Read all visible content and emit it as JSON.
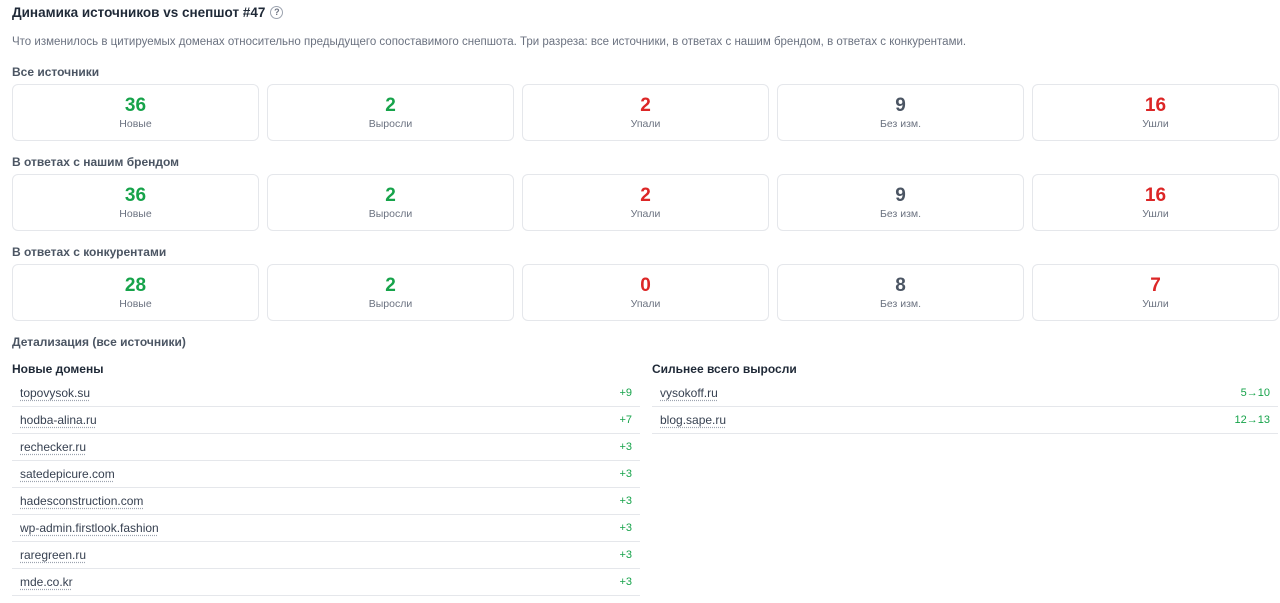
{
  "header": {
    "title": "Динамика источников vs снепшот #47",
    "help": "?",
    "subtitle": "Что изменилось в цитируемых доменах относительно предыдущего сопоставимого снепшота. Три разреза: все источники, в ответах с нашим брендом, в ответах с конкурентами."
  },
  "sections": [
    {
      "title": "Все источники",
      "cards": [
        {
          "value": "36",
          "label": "Новые",
          "color": "#16a34a"
        },
        {
          "value": "2",
          "label": "Выросли",
          "color": "#16a34a"
        },
        {
          "value": "2",
          "label": "Упали",
          "color": "#dc2626"
        },
        {
          "value": "9",
          "label": "Без изм.",
          "color": "#4b5563"
        },
        {
          "value": "16",
          "label": "Ушли",
          "color": "#dc2626"
        }
      ]
    },
    {
      "title": "В ответах с нашим брендом",
      "cards": [
        {
          "value": "36",
          "label": "Новые",
          "color": "#16a34a"
        },
        {
          "value": "2",
          "label": "Выросли",
          "color": "#16a34a"
        },
        {
          "value": "2",
          "label": "Упали",
          "color": "#dc2626"
        },
        {
          "value": "9",
          "label": "Без изм.",
          "color": "#4b5563"
        },
        {
          "value": "16",
          "label": "Ушли",
          "color": "#dc2626"
        }
      ]
    },
    {
      "title": "В ответах с конкурентами",
      "cards": [
        {
          "value": "28",
          "label": "Новые",
          "color": "#16a34a"
        },
        {
          "value": "2",
          "label": "Выросли",
          "color": "#16a34a"
        },
        {
          "value": "0",
          "label": "Упали",
          "color": "#dc2626"
        },
        {
          "value": "8",
          "label": "Без изм.",
          "color": "#4b5563"
        },
        {
          "value": "7",
          "label": "Ушли",
          "color": "#dc2626"
        }
      ]
    }
  ],
  "detail": {
    "title": "Детализация (все источники)",
    "new_domains": {
      "title": "Новые домены",
      "rows": [
        {
          "domain": "topovysok.su",
          "delta": "+9"
        },
        {
          "domain": "hodba-alina.ru",
          "delta": "+7"
        },
        {
          "domain": "rechecker.ru",
          "delta": "+3"
        },
        {
          "domain": "satedepicure.com",
          "delta": "+3"
        },
        {
          "domain": "hadesconstruction.com",
          "delta": "+3"
        },
        {
          "domain": "wp-admin.firstlook.fashion",
          "delta": "+3"
        },
        {
          "domain": "raregreen.ru",
          "delta": "+3"
        },
        {
          "domain": "mde.co.kr",
          "delta": "+3"
        }
      ]
    },
    "grew_most": {
      "title": "Сильнее всего выросли",
      "rows": [
        {
          "domain": "vysokoff.ru",
          "delta": "5→10"
        },
        {
          "domain": "blog.sape.ru",
          "delta": "12→13"
        }
      ]
    }
  }
}
